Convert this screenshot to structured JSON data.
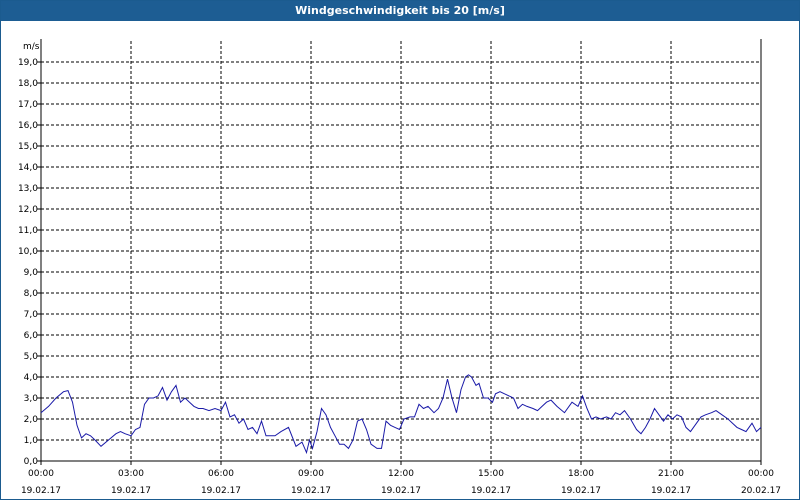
{
  "window": {
    "title": "Windgeschwindigkeit bis 20 [m/s]"
  },
  "chart_data": {
    "type": "line",
    "unit_label": "m/s",
    "ylim": [
      0,
      20
    ],
    "y_ticks": [
      "0,0",
      "1,0",
      "2,0",
      "3,0",
      "4,0",
      "5,0",
      "6,0",
      "7,0",
      "8,0",
      "9,0",
      "10,0",
      "11,0",
      "12,0",
      "13,0",
      "14,0",
      "15,0",
      "16,0",
      "17,0",
      "18,0",
      "19,0"
    ],
    "x_hours_range": [
      0,
      24
    ],
    "x_ticks": [
      {
        "time": "00:00",
        "date": "19.02.17"
      },
      {
        "time": "03:00",
        "date": "19.02.17"
      },
      {
        "time": "06:00",
        "date": "19.02.17"
      },
      {
        "time": "09:00",
        "date": "19.02.17"
      },
      {
        "time": "12:00",
        "date": "19.02.17"
      },
      {
        "time": "15:00",
        "date": "19.02.17"
      },
      {
        "time": "18:00",
        "date": "19.02.17"
      },
      {
        "time": "21:00",
        "date": "19.02.17"
      },
      {
        "time": "00:00",
        "date": "20.02.17"
      }
    ],
    "grid": true,
    "line_color": "#1a1aa8",
    "series": [
      {
        "x": [
          0.0,
          0.25,
          0.5,
          0.75,
          0.9,
          1.05,
          1.2,
          1.35,
          1.5,
          1.65,
          1.8,
          2.0,
          2.25,
          2.5,
          2.65,
          2.8,
          3.0,
          3.15,
          3.3,
          3.45,
          3.6,
          3.75,
          3.9,
          4.05,
          4.2,
          4.35,
          4.5,
          4.65,
          4.8,
          4.95,
          5.1,
          5.25,
          5.4,
          5.6,
          5.8,
          6.0,
          6.15,
          6.3,
          6.45,
          6.6,
          6.75,
          6.9,
          7.05,
          7.2,
          7.35,
          7.5,
          7.65,
          7.8,
          8.0,
          8.25,
          8.5,
          8.7,
          8.85,
          8.95,
          9.05,
          9.2,
          9.35,
          9.5,
          9.65,
          9.8,
          9.95,
          10.1,
          10.25,
          10.4,
          10.55,
          10.7,
          10.85,
          11.0,
          11.2,
          11.35,
          11.5,
          11.65,
          11.8,
          11.95,
          12.1,
          12.3,
          12.45,
          12.6,
          12.75,
          12.9,
          13.1,
          13.25,
          13.4,
          13.55,
          13.7,
          13.85,
          14.0,
          14.15,
          14.25,
          14.35,
          14.5,
          14.6,
          14.75,
          14.9,
          15.05,
          15.15,
          15.3,
          15.45,
          15.6,
          15.75,
          15.9,
          16.05,
          16.2,
          16.4,
          16.55,
          16.7,
          16.85,
          17.0,
          17.2,
          17.45,
          17.7,
          17.9,
          18.05,
          18.2,
          18.35,
          18.5,
          18.65,
          18.85,
          19.0,
          19.15,
          19.3,
          19.45,
          19.65,
          19.85,
          20.0,
          20.15,
          20.3,
          20.45,
          20.6,
          20.75,
          20.9,
          21.05,
          21.2,
          21.35,
          21.5,
          21.65,
          21.85,
          22.0,
          22.15,
          22.35,
          22.5,
          22.7,
          22.9,
          23.05,
          23.2,
          23.35,
          23.5,
          23.7,
          23.85,
          24.0
        ],
        "values": [
          2.3,
          2.6,
          3.0,
          3.3,
          3.35,
          2.8,
          1.7,
          1.1,
          1.3,
          1.2,
          1.0,
          0.7,
          1.0,
          1.3,
          1.4,
          1.3,
          1.2,
          1.5,
          1.6,
          2.7,
          3.0,
          3.0,
          3.1,
          3.5,
          2.9,
          3.3,
          3.6,
          2.8,
          3.0,
          2.8,
          2.6,
          2.5,
          2.5,
          2.4,
          2.5,
          2.4,
          2.8,
          2.1,
          2.2,
          1.8,
          2.0,
          1.5,
          1.6,
          1.3,
          1.9,
          1.2,
          1.2,
          1.2,
          1.4,
          1.6,
          0.7,
          0.9,
          0.4,
          1.0,
          0.6,
          1.4,
          2.5,
          2.2,
          1.6,
          1.2,
          0.8,
          0.8,
          0.6,
          1.0,
          1.9,
          2.0,
          1.5,
          0.8,
          0.6,
          0.6,
          1.9,
          1.7,
          1.6,
          1.5,
          2.0,
          2.1,
          2.1,
          2.7,
          2.5,
          2.6,
          2.3,
          2.5,
          3.0,
          3.9,
          3.0,
          2.3,
          3.4,
          4.0,
          4.1,
          4.0,
          3.6,
          3.7,
          3.0,
          3.0,
          2.8,
          3.2,
          3.3,
          3.2,
          3.1,
          3.0,
          2.5,
          2.7,
          2.6,
          2.5,
          2.4,
          2.6,
          2.8,
          2.9,
          2.6,
          2.3,
          2.8,
          2.6,
          3.1,
          2.5,
          2.0,
          2.1,
          2.0,
          2.1,
          2.0,
          2.3,
          2.2,
          2.4,
          2.0,
          1.5,
          1.3,
          1.6,
          2.0,
          2.5,
          2.2,
          1.9,
          2.2,
          2.0,
          2.2,
          2.1,
          1.6,
          1.4,
          1.8,
          2.1,
          2.2,
          2.3,
          2.4,
          2.2,
          2.0,
          1.8,
          1.6,
          1.5,
          1.4,
          1.8,
          1.4,
          1.6
        ]
      }
    ]
  }
}
